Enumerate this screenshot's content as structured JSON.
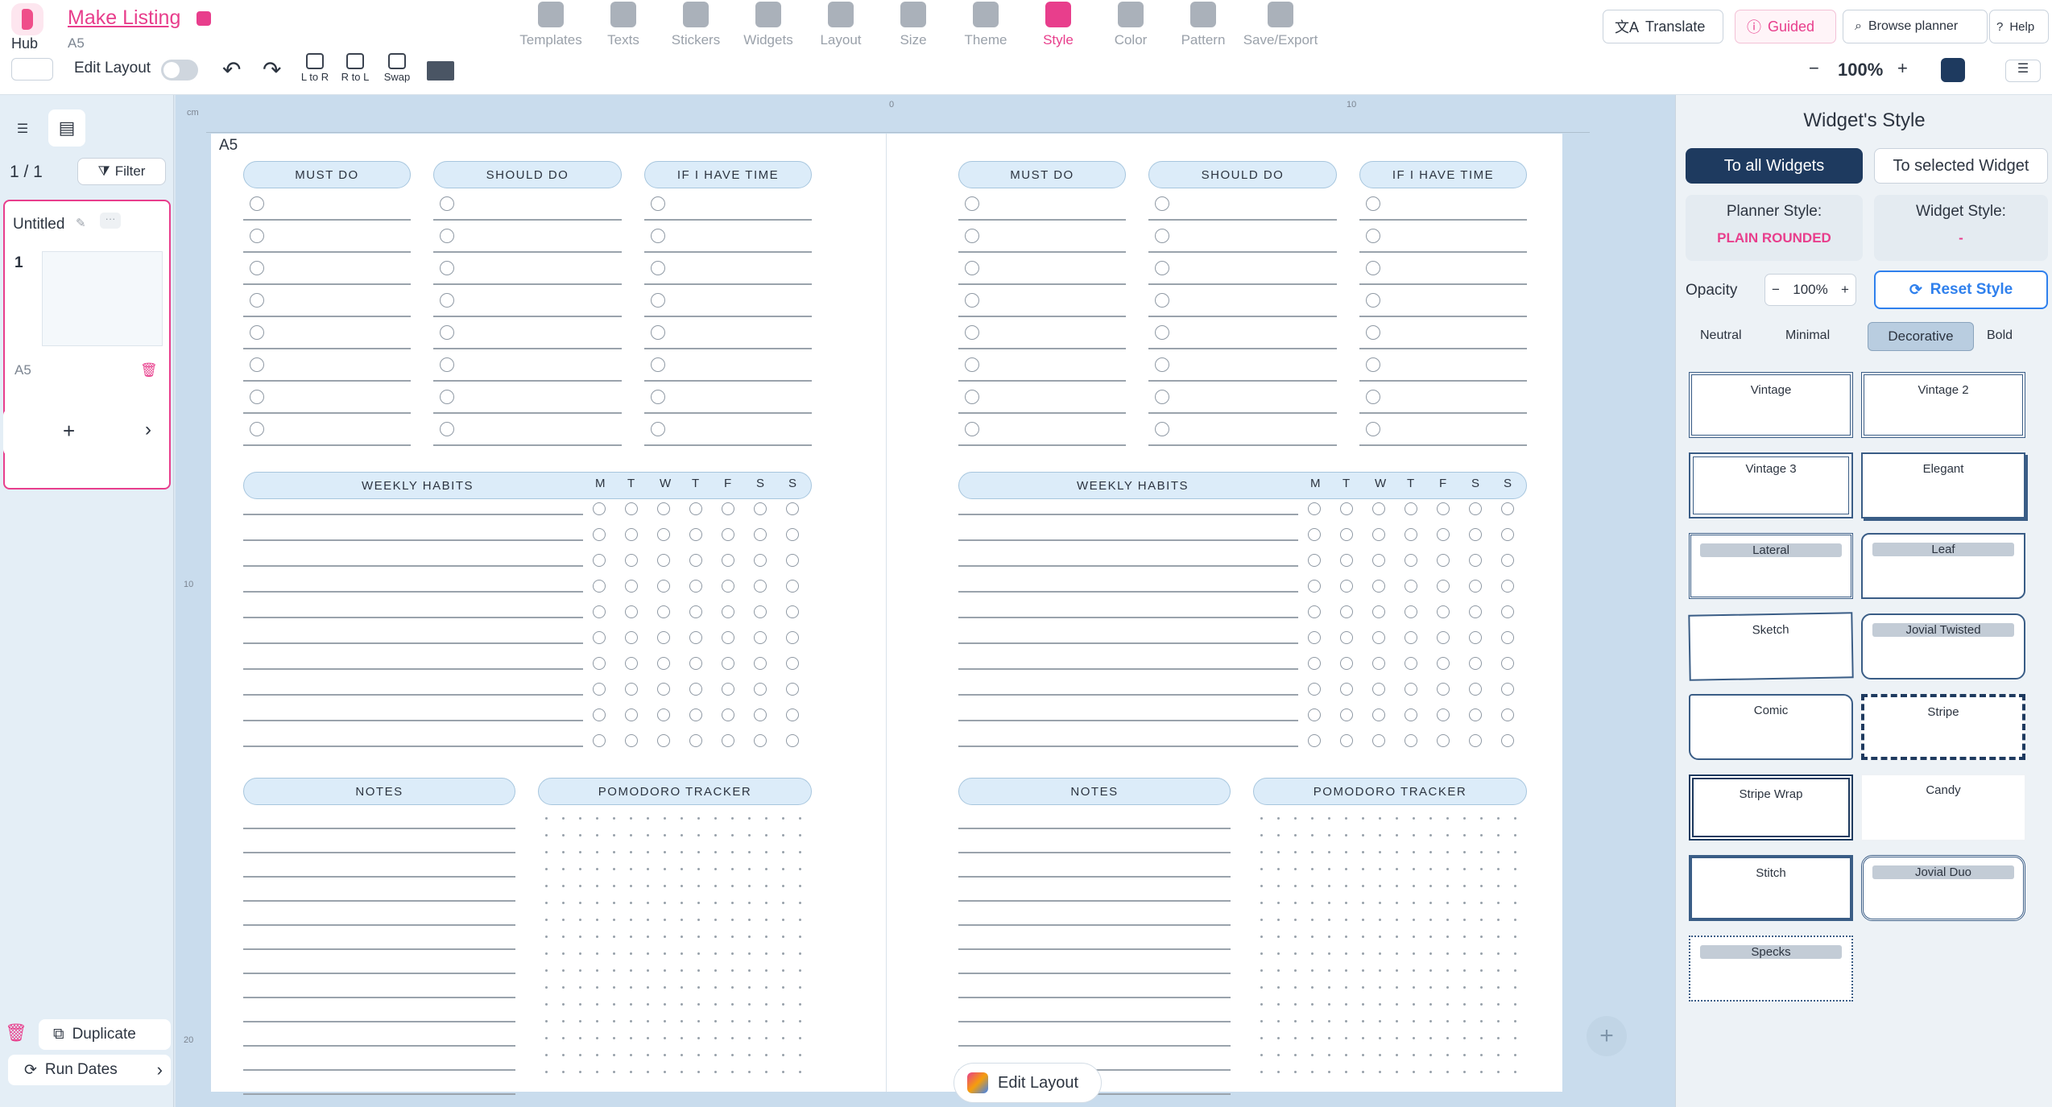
{
  "app": {
    "hub_label": "Hub",
    "title": "Make Listing",
    "page_size": "A5"
  },
  "toolbar": {
    "items": [
      {
        "label": "Templates",
        "icon": "templates-icon"
      },
      {
        "label": "Texts",
        "icon": "texts-icon"
      },
      {
        "label": "Stickers",
        "icon": "stickers-icon"
      },
      {
        "label": "Widgets",
        "icon": "widgets-icon"
      },
      {
        "label": "Layout",
        "icon": "layout-icon"
      },
      {
        "label": "Size",
        "icon": "size-icon"
      },
      {
        "label": "Theme",
        "icon": "theme-icon"
      },
      {
        "label": "Style",
        "icon": "style-icon",
        "active": true
      },
      {
        "label": "Color",
        "icon": "color-icon"
      },
      {
        "label": "Pattern",
        "icon": "pattern-icon"
      },
      {
        "label": "Save/Export",
        "icon": "save-export-icon"
      }
    ],
    "translate": "Translate",
    "guided": "Guided",
    "browse": "Browse planner",
    "help": "Help"
  },
  "subbar": {
    "edit_layout": "Edit Layout",
    "l_to_r": "L to R",
    "r_to_l": "R to L",
    "swap": "Swap",
    "zoom": "100%",
    "minus": "−",
    "plus": "+"
  },
  "left": {
    "page_count": "1 / 1",
    "filter": "Filter",
    "page_name": "Untitled",
    "page_number": "1",
    "page_size": "A5",
    "add": "+",
    "duplicate": "Duplicate",
    "run_dates": "Run Dates"
  },
  "canvas": {
    "page_label": "A5",
    "ruler_unit": "cm",
    "ruler_0": "0",
    "ruler_10": "10",
    "ruler_v10": "10",
    "ruler_v20": "20",
    "edit_layout_btn": "Edit Layout",
    "add_page": "+"
  },
  "planner": {
    "must_do": "MUST DO",
    "should_do": "SHOULD DO",
    "if_time": "IF I HAVE TIME",
    "weekly_habits": "WEEKLY HABITS",
    "days": [
      "M",
      "T",
      "W",
      "T",
      "F",
      "S",
      "S"
    ],
    "notes": "NOTES",
    "pomodoro": "POMODORO TRACKER"
  },
  "right": {
    "title": "Widget's Style",
    "to_all": "To all Widgets",
    "to_selected": "To selected Widget",
    "planner_style_label": "Planner Style:",
    "planner_style_value": "PLAIN ROUNDED",
    "widget_style_label": "Widget Style:",
    "widget_style_value": "-",
    "opacity_label": "Opacity",
    "opacity_value": "100%",
    "reset": "Reset Style",
    "filters": [
      "Neutral",
      "Minimal",
      "Decorative",
      "Bold"
    ],
    "styles": [
      "Vintage",
      "Vintage 2",
      "Vintage 3",
      "Elegant",
      "Lateral",
      "Leaf",
      "Sketch",
      "Jovial Twisted",
      "Comic",
      "Stripe",
      "Stripe Wrap",
      "Candy",
      "Stitch",
      "Jovial Duo",
      "Specks"
    ]
  },
  "colors": {
    "accent": "#e83e8c",
    "primary": "#1e3a5f",
    "header_fill": "#dcecf9"
  }
}
